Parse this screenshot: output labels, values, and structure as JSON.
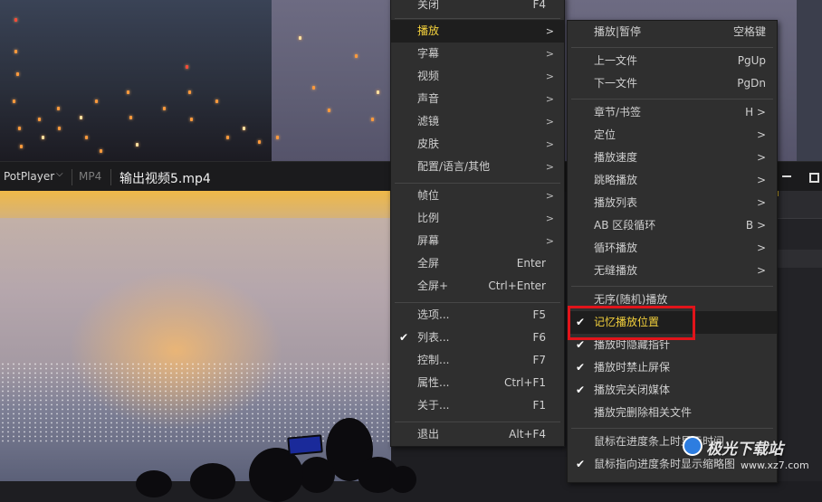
{
  "player": {
    "brand": "PotPlayer",
    "format": "MP4",
    "file_title": "输出视频5.mp4"
  },
  "main_menu": {
    "top_partial": {
      "label": "关闭",
      "shortcut": "F4"
    },
    "items": [
      {
        "label": "播放",
        "shortcut": "",
        "submenu": true,
        "highlighted": true
      },
      {
        "label": "字幕",
        "shortcut": "",
        "submenu": true
      },
      {
        "label": "视频",
        "shortcut": "",
        "submenu": true
      },
      {
        "label": "声音",
        "shortcut": "",
        "submenu": true
      },
      {
        "label": "滤镜",
        "shortcut": "",
        "submenu": true
      },
      {
        "label": "皮肤",
        "shortcut": "",
        "submenu": true
      },
      {
        "label": "配置/语言/其他",
        "shortcut": "",
        "submenu": true
      },
      {
        "label": "帧位",
        "shortcut": "",
        "submenu": true
      },
      {
        "label": "比例",
        "shortcut": "",
        "submenu": true
      },
      {
        "label": "屏幕",
        "shortcut": "",
        "submenu": true
      },
      {
        "label": "全屏",
        "shortcut": "Enter"
      },
      {
        "label": "全屏+",
        "shortcut": "Ctrl+Enter"
      },
      {
        "label": "选项...",
        "shortcut": "F5"
      },
      {
        "label": "列表...",
        "shortcut": "F6",
        "checked": true
      },
      {
        "label": "控制...",
        "shortcut": "F7"
      },
      {
        "label": "属性...",
        "shortcut": "Ctrl+F1"
      },
      {
        "label": "关于...",
        "shortcut": "F1"
      },
      {
        "label": "退出",
        "shortcut": "Alt+F4"
      }
    ],
    "submenu_arrow": ">"
  },
  "play_submenu": {
    "items": [
      {
        "label": "播放|暂停",
        "shortcut": "空格键"
      },
      {
        "label": "上一文件",
        "shortcut": "PgUp"
      },
      {
        "label": "下一文件",
        "shortcut": "PgDn"
      },
      {
        "label": "章节/书签",
        "shortcut": "H >"
      },
      {
        "label": "定位",
        "shortcut": ">"
      },
      {
        "label": "播放速度",
        "shortcut": ">"
      },
      {
        "label": "跳略播放",
        "shortcut": ">"
      },
      {
        "label": "播放列表",
        "shortcut": ">"
      },
      {
        "label": "AB 区段循环",
        "shortcut": "B >"
      },
      {
        "label": "循环播放",
        "shortcut": ">"
      },
      {
        "label": "无缝播放",
        "shortcut": ">"
      },
      {
        "label": "无序(随机)播放",
        "shortcut": ""
      },
      {
        "label": "记忆播放位置",
        "shortcut": "",
        "checked": true,
        "highlighted": true
      },
      {
        "label": "播放时隐藏指针",
        "shortcut": "",
        "checked": true
      },
      {
        "label": "播放时禁止屏保",
        "shortcut": "",
        "checked": true
      },
      {
        "label": "播放完关闭媒体",
        "shortcut": "",
        "checked": true
      },
      {
        "label": "播放完删除相关文件",
        "shortcut": ""
      },
      {
        "label": "鼠标在进度条上时显示时间",
        "shortcut": ""
      },
      {
        "label": "鼠标指向进度条时显示缩略图",
        "shortcut": "",
        "checked": true
      }
    ]
  },
  "icons": {
    "check": "✔",
    "brand_dropdown": "⌵"
  },
  "colors": {
    "highlight_text": "#f4d13c",
    "annotation_box": "#e1141a",
    "menu_bg": "#2f2f2f"
  },
  "watermark": {
    "text": "极光下载站",
    "url": "www.xz7.com"
  }
}
